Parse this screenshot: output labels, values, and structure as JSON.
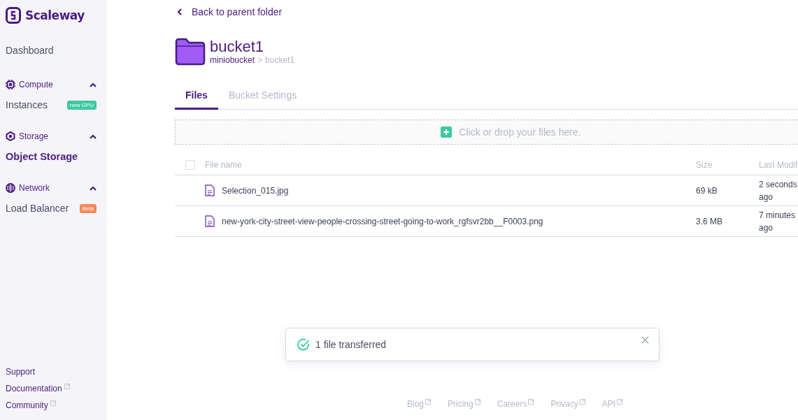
{
  "sidebar": {
    "logo": "Scaleway",
    "top_items": [
      {
        "label": "Dashboard",
        "selected": false
      }
    ],
    "groups": [
      {
        "title": "Compute",
        "kind": "chip",
        "expanded": true,
        "items": [
          {
            "label": "Instances",
            "selected": false,
            "badge": {
              "text": "new GPU",
              "color": "#3cc9a0"
            }
          }
        ]
      },
      {
        "title": "Storage",
        "kind": "hexagon",
        "expanded": true,
        "items": [
          {
            "label": "Object Storage",
            "selected": true
          }
        ]
      },
      {
        "title": "Network",
        "kind": "globe",
        "expanded": true,
        "items": [
          {
            "label": "Load Balancer",
            "selected": false,
            "badge": {
              "text": "Beta",
              "color": "#f5885f"
            }
          }
        ]
      }
    ],
    "footer_links": [
      {
        "label": "Support",
        "external": false
      },
      {
        "label": "Documentation",
        "external": true
      },
      {
        "label": "Community",
        "external": true
      }
    ]
  },
  "back_link": "Back to parent folder",
  "header": {
    "title": "bucket1",
    "breadcrumb": [
      {
        "label": "miniobucket",
        "current": false
      },
      {
        "label": "bucket1",
        "current": true
      }
    ],
    "separator": ">"
  },
  "tabs": [
    {
      "label": "Files",
      "selected": true
    },
    {
      "label": "Bucket Settings",
      "selected": false
    }
  ],
  "dropzone": "Click or drop your files here.",
  "table": {
    "select_all": {
      "checked": false
    },
    "columns": [
      "File name",
      "Size",
      "Last Modif"
    ],
    "rows": [
      {
        "name": "Selection_015.jpg",
        "size": "69 kB",
        "modified": "2 seconds ago"
      },
      {
        "name": "new-york-city-street-view-people-crossing-street-going-to-work_rgfsvr2bb__F0003.png",
        "size": "3.6 MB",
        "modified": "7 minutes ago"
      }
    ]
  },
  "toast": {
    "message": "1 file transferred"
  },
  "footer": [
    {
      "label": "Blog"
    },
    {
      "label": "Pricing"
    },
    {
      "label": "Careers"
    },
    {
      "label": "Privacy"
    },
    {
      "label": "API"
    }
  ]
}
